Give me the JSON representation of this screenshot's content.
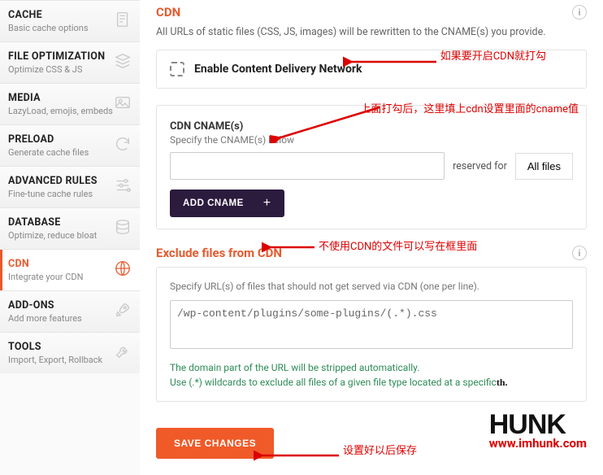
{
  "sidebar": {
    "items": [
      {
        "title": "CACHE",
        "sub": "Basic cache options"
      },
      {
        "title": "FILE OPTIMIZATION",
        "sub": "Optimize CSS & JS"
      },
      {
        "title": "MEDIA",
        "sub": "LazyLoad, emojis, embeds"
      },
      {
        "title": "PRELOAD",
        "sub": "Generate cache files"
      },
      {
        "title": "ADVANCED RULES",
        "sub": "Fine-tune cache rules"
      },
      {
        "title": "DATABASE",
        "sub": "Optimize, reduce bloat"
      },
      {
        "title": "CDN",
        "sub": "Integrate your CDN"
      },
      {
        "title": "ADD-ONS",
        "sub": "Add more features"
      },
      {
        "title": "TOOLS",
        "sub": "Import, Export, Rollback"
      }
    ]
  },
  "cdn": {
    "title": "CDN",
    "desc": "All URLs of static files (CSS, JS, images) will be rewritten to the CNAME(s) you provide.",
    "enable_label": "Enable Content Delivery Network",
    "cname_title": "CDN CNAME(s)",
    "cname_sub": "Specify the CNAME(s) below",
    "reserved_label": "reserved for",
    "allfiles_label": "All files",
    "add_cname_label": "ADD CNAME",
    "cname_value": ""
  },
  "exclude": {
    "title": "Exclude files from CDN",
    "sub": "Specify URL(s) of files that should not get served via CDN (one per line).",
    "value": "/wp-content/plugins/some-plugins/(.*).css",
    "note1": "The domain part of the URL will be stripped automatically.",
    "note2": "Use (.*) wildcards to exclude all files of a given file type located at a specific"
  },
  "save_label": "SAVE CHANGES",
  "annotations": {
    "a1": "如果要开启CDN就打勾",
    "a2": "上面打勾后，这里填上cdn设置里面的cname值",
    "a3": "不使用CDN的文件可以写在框里面",
    "a4": "设置好以后保存"
  },
  "watermark": {
    "logo": "HUNK",
    "url": "www.imhunk.com"
  },
  "note_tail": "th."
}
